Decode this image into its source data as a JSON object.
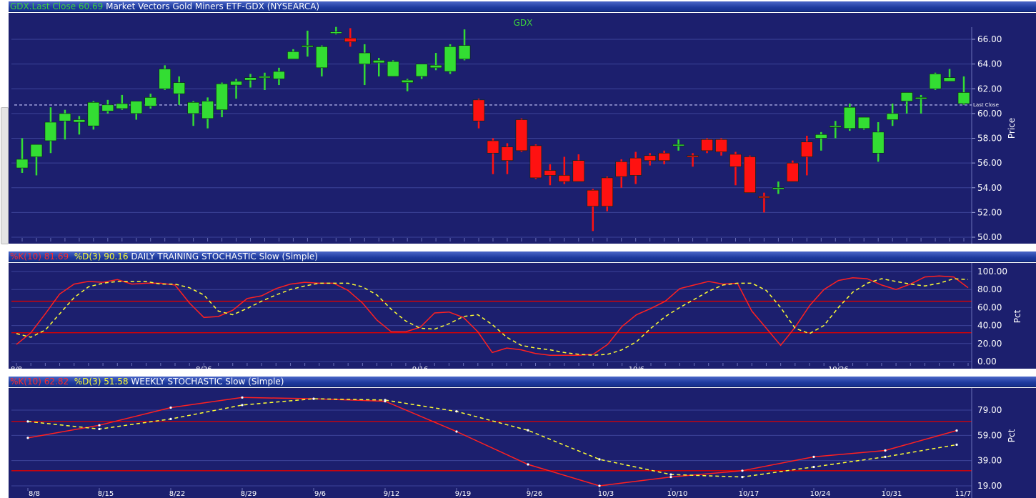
{
  "header_price": {
    "symbol": "GDX.",
    "last_close_label": "Last Close",
    "last_close_value": "60.69",
    "description": "Market Vectors Gold Miners ETF-GDX (NYSEARCA)"
  },
  "header_daily": {
    "k_label": "%K(10)",
    "k_value": "81.69",
    "d_label": "%D(3)",
    "d_value": "90.16",
    "title": "DAILY TRAINING STOCHASTIC Slow (Simple)"
  },
  "header_weekly": {
    "k_label": "%K(10)",
    "k_value": "62.82",
    "d_label": "%D(3)",
    "d_value": "51.58",
    "title": "WEEKLY STOCHASTIC Slow (Simple)"
  },
  "colors": {
    "background": "#1c1f6e",
    "grid": "#3d4399",
    "up": "#33dd33",
    "down": "#ff1111",
    "k_line": "#ff2020",
    "d_line": "#ffff33",
    "ref_lines": "#dd0000"
  },
  "chart_data": [
    {
      "type": "candlestick",
      "title": "GDX",
      "ylabel": "Price",
      "ylim": [
        49.5,
        67.2
      ],
      "yticks": [
        "66.00",
        "64.00",
        "62.00",
        "60.00",
        "58.00",
        "56.00",
        "54.00",
        "52.00",
        "50.00"
      ],
      "last_close": 60.69,
      "last_close_label": "Last Close",
      "candles": [
        {
          "o": 55.6,
          "h": 58.0,
          "l": 55.2,
          "c": 56.3
        },
        {
          "o": 56.5,
          "h": 57.5,
          "l": 55.0,
          "c": 57.5
        },
        {
          "o": 57.8,
          "h": 60.5,
          "l": 56.8,
          "c": 59.3
        },
        {
          "o": 59.4,
          "h": 60.3,
          "l": 57.9,
          "c": 60.0
        },
        {
          "o": 59.3,
          "h": 59.8,
          "l": 58.3,
          "c": 59.5
        },
        {
          "o": 59.0,
          "h": 61.0,
          "l": 58.7,
          "c": 60.9
        },
        {
          "o": 60.2,
          "h": 61.1,
          "l": 60.0,
          "c": 60.7
        },
        {
          "o": 60.4,
          "h": 61.5,
          "l": 60.3,
          "c": 60.8
        },
        {
          "o": 60.0,
          "h": 61.0,
          "l": 59.5,
          "c": 61.0
        },
        {
          "o": 60.6,
          "h": 61.6,
          "l": 60.4,
          "c": 61.3
        },
        {
          "o": 62.0,
          "h": 63.9,
          "l": 61.9,
          "c": 63.6
        },
        {
          "o": 61.6,
          "h": 63.0,
          "l": 60.7,
          "c": 62.5
        },
        {
          "o": 60.0,
          "h": 61.0,
          "l": 59.0,
          "c": 60.9
        },
        {
          "o": 59.6,
          "h": 61.3,
          "l": 58.8,
          "c": 61.0
        },
        {
          "o": 60.3,
          "h": 62.5,
          "l": 59.7,
          "c": 62.4
        },
        {
          "o": 62.3,
          "h": 62.8,
          "l": 61.2,
          "c": 62.6
        },
        {
          "o": 62.7,
          "h": 63.2,
          "l": 62.1,
          "c": 62.9
        },
        {
          "o": 62.9,
          "h": 63.3,
          "l": 61.9,
          "c": 63.0
        },
        {
          "o": 62.8,
          "h": 63.7,
          "l": 62.3,
          "c": 63.4
        },
        {
          "o": 64.4,
          "h": 65.2,
          "l": 64.4,
          "c": 65.0
        },
        {
          "o": 65.5,
          "h": 66.7,
          "l": 64.6,
          "c": 65.5
        },
        {
          "o": 63.7,
          "h": 65.5,
          "l": 63.0,
          "c": 65.4
        },
        {
          "o": 66.5,
          "h": 67.0,
          "l": 66.4,
          "c": 66.6
        },
        {
          "o": 66.1,
          "h": 66.9,
          "l": 65.4,
          "c": 65.8
        },
        {
          "o": 64.0,
          "h": 65.6,
          "l": 62.3,
          "c": 64.9
        },
        {
          "o": 64.1,
          "h": 64.5,
          "l": 63.0,
          "c": 64.3
        },
        {
          "o": 63.0,
          "h": 64.3,
          "l": 63.0,
          "c": 64.2
        },
        {
          "o": 62.5,
          "h": 62.8,
          "l": 61.8,
          "c": 62.7
        },
        {
          "o": 63.0,
          "h": 64.0,
          "l": 62.8,
          "c": 64.0
        },
        {
          "o": 63.7,
          "h": 64.9,
          "l": 63.5,
          "c": 63.9
        },
        {
          "o": 63.4,
          "h": 65.6,
          "l": 63.2,
          "c": 65.4
        },
        {
          "o": 64.4,
          "h": 66.8,
          "l": 64.3,
          "c": 65.5
        },
        {
          "o": 61.1,
          "h": 61.2,
          "l": 58.8,
          "c": 59.4
        },
        {
          "o": 57.8,
          "h": 58.0,
          "l": 55.1,
          "c": 56.8
        },
        {
          "o": 57.3,
          "h": 57.6,
          "l": 55.1,
          "c": 56.2
        },
        {
          "o": 59.5,
          "h": 59.6,
          "l": 56.9,
          "c": 57.0
        },
        {
          "o": 57.4,
          "h": 57.5,
          "l": 54.7,
          "c": 54.8
        },
        {
          "o": 55.4,
          "h": 55.9,
          "l": 54.2,
          "c": 55.0
        },
        {
          "o": 55.0,
          "h": 56.5,
          "l": 54.3,
          "c": 54.5
        },
        {
          "o": 56.2,
          "h": 56.7,
          "l": 54.5,
          "c": 54.5
        },
        {
          "o": 53.8,
          "h": 53.9,
          "l": 50.5,
          "c": 52.5
        },
        {
          "o": 54.8,
          "h": 54.9,
          "l": 52.1,
          "c": 52.5
        },
        {
          "o": 56.1,
          "h": 56.3,
          "l": 54.0,
          "c": 54.9
        },
        {
          "o": 56.4,
          "h": 56.9,
          "l": 54.3,
          "c": 55.0
        },
        {
          "o": 56.6,
          "h": 56.8,
          "l": 55.8,
          "c": 56.2
        },
        {
          "o": 56.8,
          "h": 57.0,
          "l": 55.9,
          "c": 56.2
        },
        {
          "o": 57.4,
          "h": 57.9,
          "l": 57.0,
          "c": 57.5
        },
        {
          "o": 56.6,
          "h": 56.8,
          "l": 55.7,
          "c": 56.5
        },
        {
          "o": 57.9,
          "h": 58.0,
          "l": 56.8,
          "c": 57.0
        },
        {
          "o": 57.9,
          "h": 58.0,
          "l": 56.6,
          "c": 56.9
        },
        {
          "o": 56.7,
          "h": 56.9,
          "l": 54.2,
          "c": 55.7
        },
        {
          "o": 56.5,
          "h": 56.6,
          "l": 53.6,
          "c": 53.6
        },
        {
          "o": 53.3,
          "h": 53.6,
          "l": 52.0,
          "c": 53.2
        },
        {
          "o": 54.0,
          "h": 54.5,
          "l": 53.5,
          "c": 54.0
        },
        {
          "o": 56.0,
          "h": 56.2,
          "l": 54.5,
          "c": 54.5
        },
        {
          "o": 57.7,
          "h": 58.2,
          "l": 55.0,
          "c": 56.5
        },
        {
          "o": 58.0,
          "h": 58.5,
          "l": 57.0,
          "c": 58.3
        },
        {
          "o": 59.0,
          "h": 59.4,
          "l": 58.0,
          "c": 59.0
        },
        {
          "o": 58.8,
          "h": 60.8,
          "l": 58.6,
          "c": 60.5
        },
        {
          "o": 58.8,
          "h": 59.7,
          "l": 58.7,
          "c": 59.7
        },
        {
          "o": 56.8,
          "h": 59.3,
          "l": 56.1,
          "c": 58.5
        },
        {
          "o": 59.5,
          "h": 60.8,
          "l": 59.0,
          "c": 60.0
        },
        {
          "o": 61.0,
          "h": 61.7,
          "l": 60.0,
          "c": 61.7
        },
        {
          "o": 61.2,
          "h": 61.5,
          "l": 60.0,
          "c": 61.3
        },
        {
          "o": 62.0,
          "h": 63.3,
          "l": 61.9,
          "c": 63.2
        },
        {
          "o": 62.6,
          "h": 63.6,
          "l": 62.6,
          "c": 62.9
        },
        {
          "o": 60.8,
          "h": 63.0,
          "l": 60.7,
          "c": 61.7
        }
      ]
    },
    {
      "type": "line",
      "title": "DAILY TRAINING STOCHASTIC Slow (Simple)",
      "ylabel": "Pct",
      "ylim": [
        0,
        100
      ],
      "yticks": [
        "100.00",
        "80.00",
        "60.00",
        "40.00",
        "20.00",
        "0.00"
      ],
      "ref_lines": [
        67,
        32
      ],
      "xticks": [
        {
          "index": 0,
          "label": "8/8"
        },
        {
          "index": 13,
          "label": "8/26"
        },
        {
          "index": 28,
          "label": "9/16"
        },
        {
          "index": 43,
          "label": "10/6"
        },
        {
          "index": 57,
          "label": "10/26"
        }
      ],
      "series": [
        {
          "name": "%K(10)",
          "style": "solid",
          "values": [
            19,
            32,
            53,
            75,
            86,
            89,
            88,
            91,
            86,
            87,
            87,
            85,
            65,
            49,
            50,
            57,
            70,
            73,
            81,
            86,
            88,
            87,
            87,
            79,
            65,
            46,
            33,
            33,
            38,
            54,
            55,
            49,
            33,
            10,
            15,
            13,
            9,
            7,
            7,
            7,
            8,
            19,
            39,
            52,
            59,
            67,
            81,
            85,
            89,
            86,
            87,
            56,
            37,
            18,
            38,
            62,
            80,
            90,
            93,
            92,
            85,
            80,
            86,
            94,
            95,
            94,
            82
          ]
        },
        {
          "name": "%D(3)",
          "style": "dashed",
          "values": [
            31,
            27,
            35,
            53,
            71,
            83,
            87,
            89,
            89,
            89,
            86,
            86,
            82,
            74,
            56,
            52,
            59,
            67,
            74,
            80,
            84,
            87,
            87,
            87,
            83,
            74,
            58,
            45,
            37,
            36,
            42,
            50,
            52,
            41,
            27,
            18,
            15,
            13,
            10,
            8,
            7,
            8,
            13,
            22,
            37,
            50,
            60,
            69,
            78,
            85,
            87,
            87,
            79,
            60,
            37,
            31,
            40,
            60,
            77,
            87,
            92,
            89,
            86,
            84,
            87,
            92,
            91
          ]
        }
      ]
    },
    {
      "type": "line",
      "title": "WEEKLY STOCHASTIC Slow (Simple)",
      "ylabel": "Pct",
      "ylim": [
        17,
        91
      ],
      "yticks": [
        "79.00",
        "59.00",
        "39.00",
        "19.00"
      ],
      "ref_lines": [
        70,
        31
      ],
      "categories": [
        "8/8",
        "8/15",
        "8/22",
        "8/29",
        "9/6",
        "9/12",
        "9/19",
        "9/26",
        "10/3",
        "10/10",
        "10/17",
        "10/24",
        "10/31",
        "11/7"
      ],
      "series": [
        {
          "name": "%K(10)",
          "style": "solid",
          "values": [
            57,
            67,
            81,
            89,
            88,
            86,
            62,
            36,
            19,
            26,
            31,
            42,
            47,
            62.8
          ]
        },
        {
          "name": "%D(3)",
          "style": "dashed",
          "values": [
            70,
            64,
            72,
            83,
            88,
            87,
            78,
            63,
            40,
            28,
            26,
            34,
            42,
            51.6
          ]
        }
      ]
    }
  ]
}
